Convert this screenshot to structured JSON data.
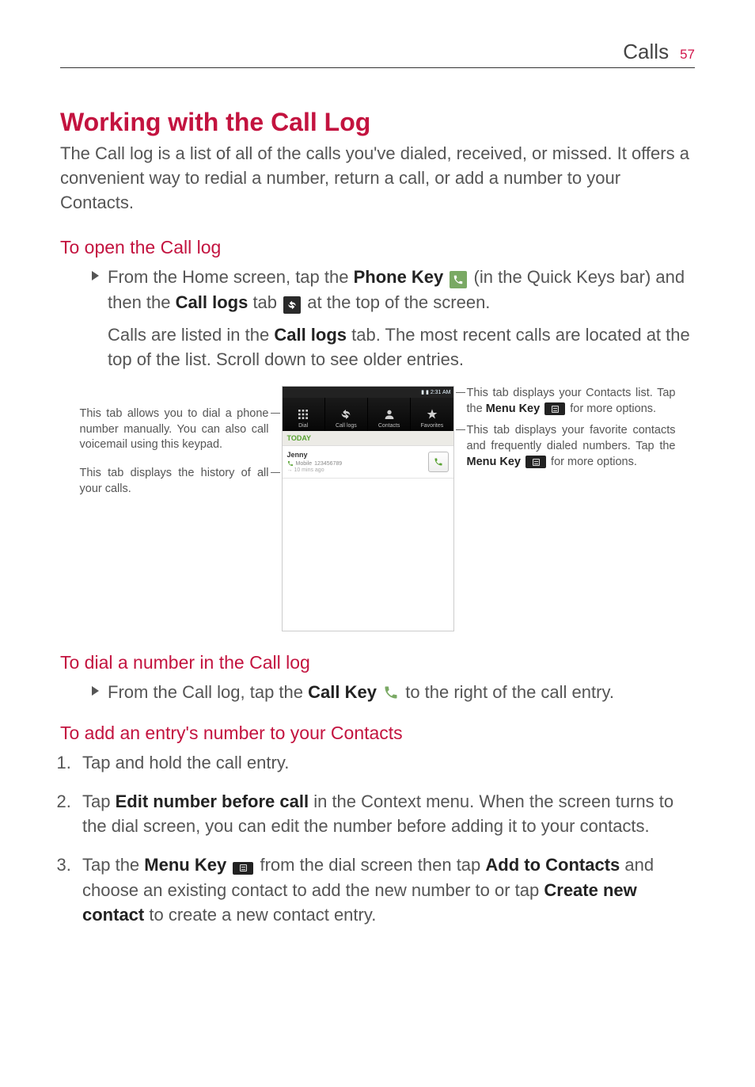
{
  "header": {
    "section": "Calls",
    "page_number": "57"
  },
  "title": "Working with the Call Log",
  "intro": "The Call log is a list of all of the calls you've dialed, received, or missed. It offers a convenient way to redial a number, return a call, or add a number to your Contacts.",
  "open_heading": "To open the Call log",
  "open_bullet": {
    "p1a": "From the Home screen, tap the ",
    "phone_key": "Phone Key",
    "p1b": " (in the Quick Keys bar) and then the ",
    "call_logs_tab": "Call logs",
    "p1c": " tab ",
    "p1d": " at the top of the screen."
  },
  "open_para2": {
    "a": "Calls are listed in the ",
    "b": "Call logs",
    "c": " tab. The most recent calls are located at the top of the list. Scroll down to see older entries."
  },
  "callouts": {
    "left1": "This tab allows you to dial a phone number manually. You can also call voicemail using this keypad.",
    "left2": "This tab displays the history of all your calls.",
    "right1a": "This tab displays your Contacts list. Tap the ",
    "right1_menu": "Menu Key",
    "right1b": " for more options.",
    "right2a": "This tab displays your favorite contacts and frequently dialed numbers. Tap the ",
    "right2_menu": "Menu Key",
    "right2b": " for more options."
  },
  "phone_mock": {
    "status_time": "2:31 AM",
    "tabs": [
      "Dial",
      "Call logs",
      "Contacts",
      "Favorites"
    ],
    "today": "TODAY",
    "entry_name": "Jenny",
    "entry_type": "Mobile",
    "entry_number": "123456789",
    "entry_time": "10 mins ago"
  },
  "dial_heading": "To dial a number in the Call log",
  "dial_bullet": {
    "a": "From the Call log, tap the ",
    "b": "Call Key",
    "c": " to the right of the call entry."
  },
  "add_heading": "To add an entry's number to your Contacts",
  "steps": {
    "s1": "Tap and hold the call entry.",
    "s2a": "Tap ",
    "s2_bold1": "Edit number before call",
    "s2b": " in the Context menu. When the screen turns to the dial screen, you can edit the number before adding it to your contacts.",
    "s3a": "Tap the ",
    "s3_bold1": "Menu Key",
    "s3b": " from the dial screen then tap ",
    "s3_bold2": "Add to Contacts",
    "s3c": " and choose an existing contact to add the new number to or tap ",
    "s3_bold3": "Create new contact",
    "s3d": " to create a new contact entry."
  }
}
